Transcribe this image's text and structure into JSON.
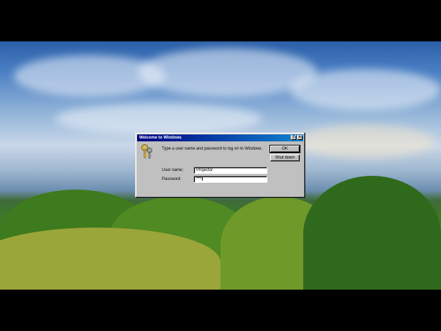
{
  "dialog": {
    "title": "Welcome to Windows",
    "help_label": "?",
    "close_label": "×",
    "prompt": "Type a user name and password to log on to Windows.",
    "ok_label": "OK",
    "shutdown_label": "Shut down",
    "username_label": "User name:",
    "username_value": "Projector",
    "password_label": "Password:",
    "password_value": "***"
  },
  "colors": {
    "titlebar_start": "#000080",
    "titlebar_end": "#1084d0",
    "dialog_face": "#c0c0c0"
  },
  "icons": [
    "keys-icon",
    "help-icon",
    "close-icon"
  ]
}
